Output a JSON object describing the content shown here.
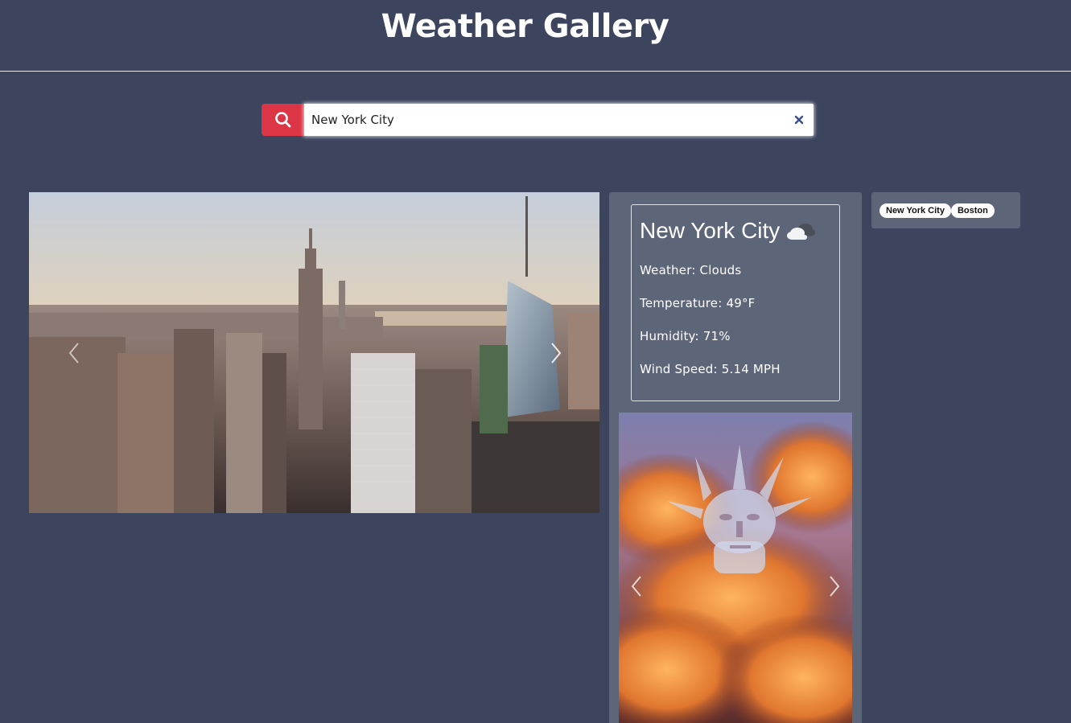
{
  "header": {
    "title": "Weather Gallery"
  },
  "search": {
    "value": "New York City",
    "button_icon": "search-icon",
    "clear_icon": "close-icon",
    "button_color": "#dc3545"
  },
  "hero_carousel": {
    "image": "New York City skyline at sunset",
    "prev_icon": "chevron-left-icon",
    "next_icon": "chevron-right-icon"
  },
  "weather": {
    "city": "New York City",
    "icon": "clouds-icon",
    "rows": [
      {
        "label": "Weather:",
        "value": "Clouds"
      },
      {
        "label": "Temperature:",
        "value": "49°F"
      },
      {
        "label": "Humidity:",
        "value": "71%"
      },
      {
        "label": "Wind Speed:",
        "value": "5.14 MPH"
      }
    ]
  },
  "gif_carousel": {
    "image": "Statue of Liberty face in orange clouds",
    "prev_icon": "chevron-left-icon",
    "next_icon": "chevron-right-icon"
  },
  "history": {
    "items": [
      "New York City",
      "Boston"
    ]
  },
  "colors": {
    "background": "#3c455d",
    "panel": "#5d6578",
    "accent": "#dc3545"
  }
}
